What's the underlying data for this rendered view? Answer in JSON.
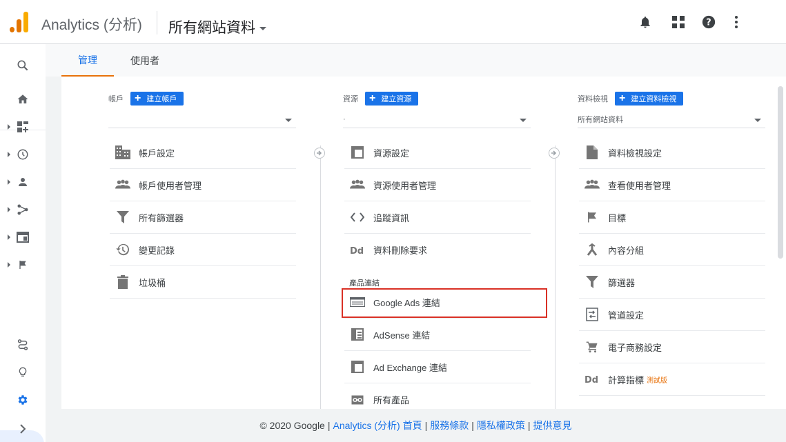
{
  "header": {
    "brand": "Analytics (分析)",
    "property_name": "所有網站資料",
    "icons": [
      "bell-icon",
      "apps-grid-icon",
      "help-icon",
      "more-vert-icon"
    ]
  },
  "tabs": [
    {
      "label": "管理",
      "active": true
    },
    {
      "label": "使用者",
      "active": false
    }
  ],
  "columns": {
    "account": {
      "title": "帳戶",
      "create_label": "建立帳戶",
      "selector_value": "",
      "items": [
        {
          "label": "帳戶設定",
          "icon": "building-icon"
        },
        {
          "label": "帳戶使用者管理",
          "icon": "people-icon"
        },
        {
          "label": "所有篩選器",
          "icon": "filter-icon"
        },
        {
          "label": "變更記錄",
          "icon": "history-icon"
        },
        {
          "label": "垃圾桶",
          "icon": "trash-icon"
        }
      ]
    },
    "property": {
      "title": "資源",
      "create_label": "建立資源",
      "selector_value": "·",
      "items": [
        {
          "label": "資源設定",
          "icon": "window-icon"
        },
        {
          "label": "資源使用者管理",
          "icon": "people-icon"
        },
        {
          "label": "追蹤資訊",
          "icon": "code-icon"
        },
        {
          "label": "資料刪除要求",
          "icon": "dd-icon"
        }
      ],
      "product_links_label": "產品連結",
      "product_items": [
        {
          "label": "Google Ads 連結",
          "icon": "ads-icon"
        },
        {
          "label": "AdSense 連結",
          "icon": "adsense-icon"
        },
        {
          "label": "Ad Exchange 連結",
          "icon": "window-icon"
        },
        {
          "label": "所有產品",
          "icon": "link-icon"
        }
      ]
    },
    "view": {
      "title": "資料檢視",
      "create_label": "建立資料檢視",
      "selector_value": "所有網站資料",
      "items": [
        {
          "label": "資料檢視設定",
          "icon": "doc-icon"
        },
        {
          "label": "查看使用者管理",
          "icon": "people-icon"
        },
        {
          "label": "目標",
          "icon": "flag-icon"
        },
        {
          "label": "內容分組",
          "icon": "grouping-icon"
        },
        {
          "label": "篩選器",
          "icon": "filter-icon"
        },
        {
          "label": "管道設定",
          "icon": "channel-icon"
        },
        {
          "label": "電子商務設定",
          "icon": "cart-icon"
        },
        {
          "label": "計算指標",
          "icon": "dd-icon",
          "badge": "測試版"
        }
      ]
    }
  },
  "footer": {
    "copyright": "© 2020 Google",
    "links": [
      "Analytics (分析) 首頁",
      "服務條款",
      "隱私權政策",
      "提供意見"
    ]
  },
  "colors": {
    "accent": "#1a73e8",
    "tab_underline": "#e8710a",
    "highlight": "#d93025"
  }
}
